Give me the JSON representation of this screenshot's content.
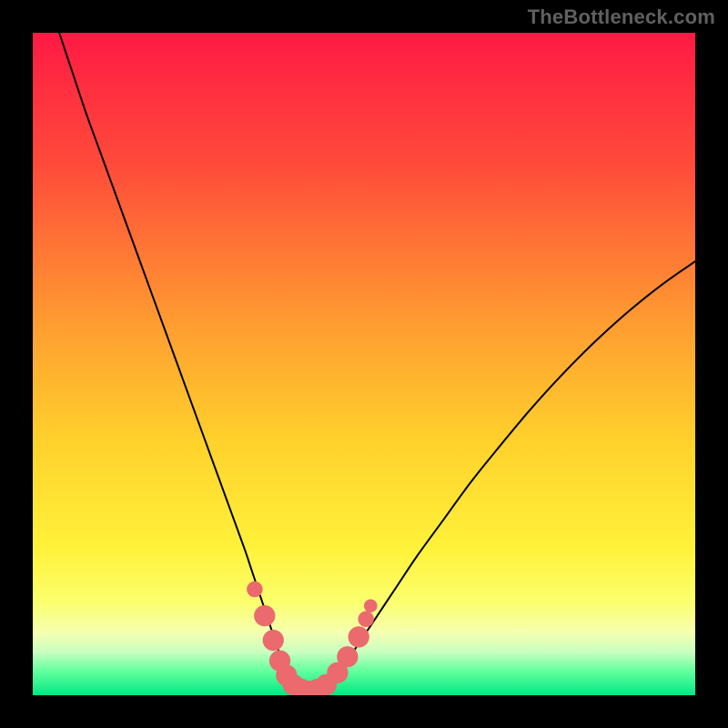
{
  "watermark": {
    "text": "TheBottleneck.com"
  },
  "colors": {
    "frame": "#000000",
    "curve": "#000000",
    "marker": "#ea6a6e",
    "gradient_stops": [
      {
        "offset": 0.0,
        "color": "#ff1a44"
      },
      {
        "offset": 0.2,
        "color": "#ff4b3a"
      },
      {
        "offset": 0.45,
        "color": "#ffa030"
      },
      {
        "offset": 0.62,
        "color": "#ffd22c"
      },
      {
        "offset": 0.78,
        "color": "#fff23a"
      },
      {
        "offset": 0.86,
        "color": "#fbff6e"
      },
      {
        "offset": 0.905,
        "color": "#f6ffb0"
      },
      {
        "offset": 0.935,
        "color": "#c8ffc0"
      },
      {
        "offset": 0.965,
        "color": "#5eff9c"
      },
      {
        "offset": 1.0,
        "color": "#00e884"
      }
    ]
  },
  "chart_data": {
    "type": "line",
    "title": "",
    "xlabel": "",
    "ylabel": "",
    "xlim": [
      0,
      100
    ],
    "ylim": [
      0,
      100
    ],
    "grid": false,
    "legend": false,
    "series": [
      {
        "name": "bottleneck-curve",
        "x": [
          4,
          6,
          8,
          10,
          12,
          14,
          16,
          18,
          20,
          22,
          24,
          26,
          28,
          30,
          32,
          33,
          34,
          35,
          36,
          37,
          38,
          39,
          40,
          41,
          42,
          43,
          44,
          46,
          48,
          50,
          52,
          55,
          58,
          62,
          66,
          70,
          75,
          80,
          85,
          90,
          95,
          100
        ],
        "y": [
          100,
          94,
          88,
          82.5,
          77,
          71.5,
          66,
          60.5,
          55,
          49.5,
          44,
          38.5,
          33,
          27.5,
          22,
          19,
          16,
          13,
          10,
          7,
          4.5,
          2.5,
          1.3,
          0.8,
          0.6,
          0.8,
          1.3,
          3.2,
          6,
          9,
          12,
          16.5,
          21,
          26.5,
          32,
          37,
          43,
          48.5,
          53.5,
          58,
          62,
          65.5
        ]
      }
    ],
    "markers": {
      "name": "highlight-points",
      "points": [
        {
          "x": 33.5,
          "y": 16.0,
          "r": 1.2
        },
        {
          "x": 35.0,
          "y": 12.0,
          "r": 1.6
        },
        {
          "x": 36.3,
          "y": 8.3,
          "r": 1.6
        },
        {
          "x": 37.3,
          "y": 5.2,
          "r": 1.6
        },
        {
          "x": 38.3,
          "y": 3.0,
          "r": 1.6
        },
        {
          "x": 39.3,
          "y": 1.6,
          "r": 1.6
        },
        {
          "x": 40.5,
          "y": 0.9,
          "r": 1.6
        },
        {
          "x": 41.8,
          "y": 0.6,
          "r": 1.6
        },
        {
          "x": 43.0,
          "y": 0.9,
          "r": 1.6
        },
        {
          "x": 44.3,
          "y": 1.6,
          "r": 1.6
        },
        {
          "x": 46.0,
          "y": 3.4,
          "r": 1.6
        },
        {
          "x": 47.5,
          "y": 5.8,
          "r": 1.6
        },
        {
          "x": 49.2,
          "y": 8.8,
          "r": 1.6
        },
        {
          "x": 50.3,
          "y": 11.5,
          "r": 1.2
        },
        {
          "x": 51.0,
          "y": 13.5,
          "r": 1.0
        }
      ]
    }
  }
}
